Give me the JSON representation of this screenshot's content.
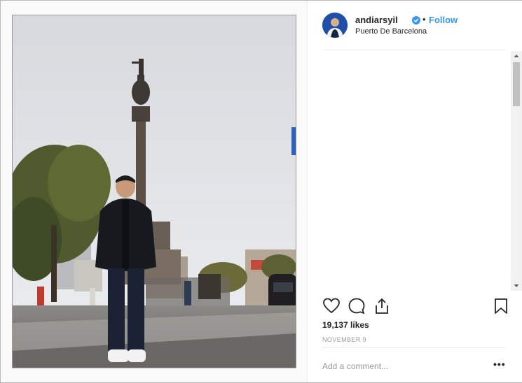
{
  "post": {
    "username": "andiarsyil",
    "follow_label": "Follow",
    "separator": "•",
    "location": "Puerto De Barcelona",
    "likes": "19,137 likes",
    "date": "NOVEMBER 9",
    "comment_placeholder": "Add a comment...",
    "more_label": "•••"
  },
  "icons": {
    "like": "heart-outline-icon",
    "comment": "speech-bubble-icon",
    "share": "share-upload-icon",
    "save": "bookmark-outline-icon",
    "verified": "verified-badge-icon"
  },
  "colors": {
    "accent": "#3897f0",
    "text": "#262626",
    "muted": "#999999"
  }
}
